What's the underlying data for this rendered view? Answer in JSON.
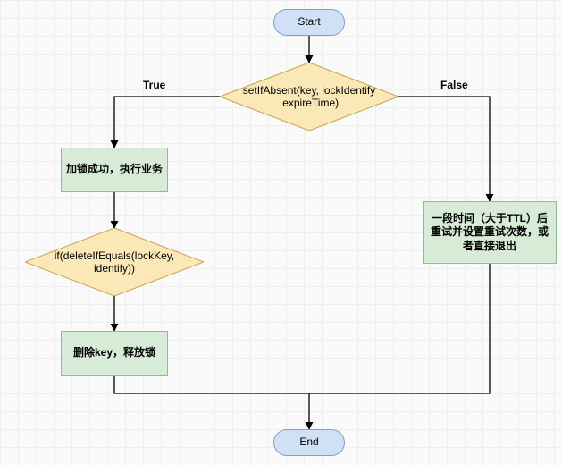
{
  "chart_data": {
    "type": "flowchart",
    "title": "",
    "nodes": [
      {
        "id": "start",
        "type": "terminator",
        "label": "Start"
      },
      {
        "id": "decision1",
        "type": "decision",
        "label": "setIfAbsent(key, lockIdentify ,expireTime)"
      },
      {
        "id": "process_true",
        "type": "process",
        "label": "加锁成功，执行业务"
      },
      {
        "id": "decision2",
        "type": "decision",
        "label": "if(deleteIfEquals(lockKey, identify))"
      },
      {
        "id": "process_release",
        "type": "process",
        "label": "删除key，释放锁"
      },
      {
        "id": "process_false",
        "type": "process",
        "label": "一段时间（大于TTL）后重试并设置重试次数，或者直接退出"
      },
      {
        "id": "end",
        "type": "terminator",
        "label": "End"
      }
    ],
    "edges": [
      {
        "from": "start",
        "to": "decision1"
      },
      {
        "from": "decision1",
        "to": "process_true",
        "label": "True"
      },
      {
        "from": "decision1",
        "to": "process_false",
        "label": "False"
      },
      {
        "from": "process_true",
        "to": "decision2"
      },
      {
        "from": "decision2",
        "to": "process_release"
      },
      {
        "from": "process_release",
        "to": "end"
      },
      {
        "from": "process_false",
        "to": "end"
      }
    ]
  },
  "labels": {
    "true": "True",
    "false": "False"
  }
}
